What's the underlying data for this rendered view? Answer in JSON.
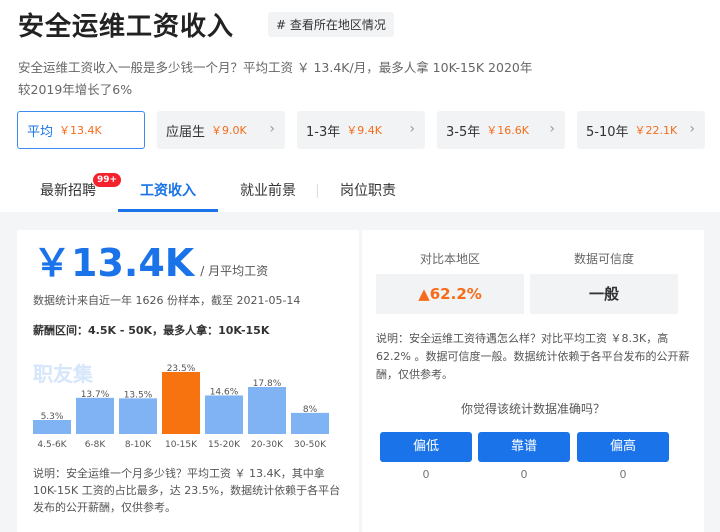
{
  "header": {
    "title": "安全运维工资收入",
    "region_tag": "# 查看所在地区情况",
    "description": "安全运维工资收入一般是多少钱一个月？平均工资 ￥ 13.4K/月，最多人拿 10K-15K 2020年较2019年增长了6%"
  },
  "levels": [
    {
      "label": "平均",
      "value": "￥13.4K",
      "active": true
    },
    {
      "label": "应届生",
      "value": "￥9.0K",
      "active": false
    },
    {
      "label": "1-3年",
      "value": "￥9.4K",
      "active": false
    },
    {
      "label": "3-5年",
      "value": "￥16.6K",
      "active": false
    },
    {
      "label": "5-10年",
      "value": "￥22.1K",
      "active": false
    }
  ],
  "tabs": [
    {
      "label": "最新招聘",
      "badge": "99+"
    },
    {
      "label": "工资收入"
    },
    {
      "label": "就业前景"
    },
    {
      "label": "岗位职责"
    }
  ],
  "salary": {
    "amount": "￥13.4K",
    "unit": "/ 月平均工资",
    "source_note": "数据统计来自近一年 1626 份样本，截至 2021-05-14",
    "range_line": "薪酬区间：4.5K - 50K，最多人拿：10K-15K",
    "watermark": "职友集"
  },
  "chart_data": {
    "type": "bar",
    "categories": [
      "4.5-6K",
      "6-8K",
      "8-10K",
      "10-15K",
      "15-20K",
      "20-30K",
      "30-50K"
    ],
    "values": [
      5.3,
      13.7,
      13.5,
      23.5,
      14.6,
      17.8,
      8
    ],
    "value_labels": [
      "5.3%",
      "13.7%",
      "13.5%",
      "23.5%",
      "14.6%",
      "17.8%",
      "8%"
    ],
    "highlight_index": 3,
    "colors": {
      "bar": "#7fb3f4",
      "highlight": "#f7730f"
    },
    "ylim": [
      0,
      25
    ]
  },
  "chart_desc": "说明：安全运维一个月多少钱？平均工资 ￥ 13.4K，其中拿 10K-15K 工资的占比最多，达 23.5%，数据统计依赖于各平台发布的公开薪酬，仅供参考。",
  "compare": {
    "local_label": "对比本地区",
    "local_value": "62.2%",
    "confidence_label": "数据可信度",
    "confidence_value": "一般",
    "desc": "说明：安全运维工资待遇怎么样？对比平均工资 ￥8.3K，高 62.2% 。数据可信度一般。数据统计依赖于各平台发布的公开薪酬，仅供参考。",
    "question": "你觉得该统计数据准确吗？",
    "votes": [
      {
        "label": "偏低",
        "count": "0"
      },
      {
        "label": "靠谱",
        "count": "0"
      },
      {
        "label": "偏高",
        "count": "0"
      }
    ]
  },
  "colors": {
    "accent": "#1a73e8",
    "orange": "#f56c1a"
  }
}
